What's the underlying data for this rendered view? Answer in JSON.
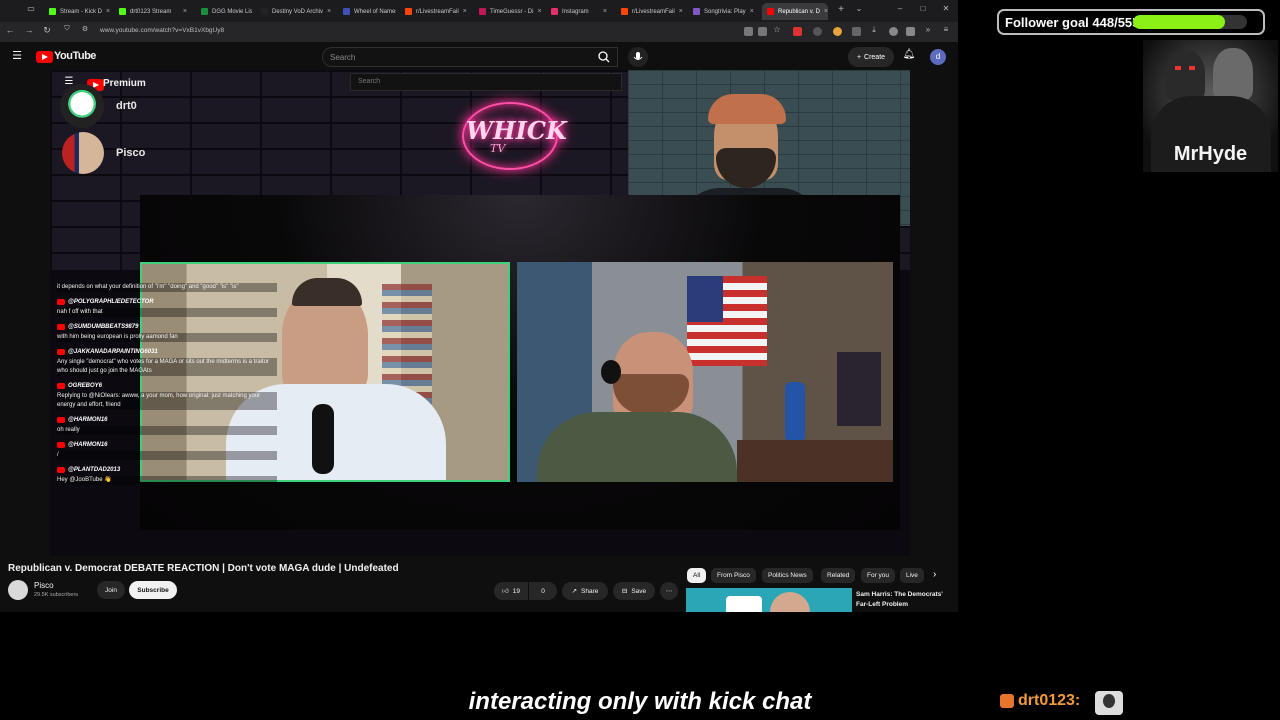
{
  "browser": {
    "tabs": [
      {
        "label": "Stream - Kick D",
        "favicon_color": "#53fc18"
      },
      {
        "label": "drt0123 Stream",
        "favicon_color": "#53fc18"
      },
      {
        "label": "DGG Movie List",
        "favicon_color": "#1e8e3e"
      },
      {
        "label": "Destiny VoD Archiv",
        "favicon_color": "#222222"
      },
      {
        "label": "Wheel of Names",
        "favicon_color": "#3f51b5"
      },
      {
        "label": "r/LivestreamFail",
        "favicon_color": "#ff4500"
      },
      {
        "label": "TimeGuessr - Di",
        "favicon_color": "#c2185b"
      },
      {
        "label": "Instagram",
        "favicon_color": "#e1306c"
      },
      {
        "label": "r/LivestreamFail",
        "favicon_color": "#ff4500"
      },
      {
        "label": "Songtrivia: Play",
        "favicon_color": "#7e57c2"
      },
      {
        "label": "Republican v. D",
        "favicon_color": "#ff0000"
      }
    ],
    "url": "www.youtube.com/watch?v=VxB1vXbgUy8"
  },
  "youtube": {
    "search_placeholder": "Search",
    "create_label": "Create",
    "avatar_letter": "d",
    "video": {
      "title": "Republican v. Democrat DEBATE REACTION | Don't vote MAGA dude | Undefeated",
      "channel": "Pisco",
      "subscribers": "29.5K subscribers",
      "join_label": "Join",
      "subscribe_label": "Subscribe",
      "likes": "19",
      "dislikes": "0",
      "share_label": "Share",
      "save_label": "Save"
    },
    "chips": [
      "All",
      "From Pisco",
      "Politics News",
      "Related",
      "For you",
      "Live"
    ],
    "recommended": {
      "title": "Sam Harris: The Democrats' Far-Left Problem"
    }
  },
  "embedded_stream": {
    "premium_label": "Premium",
    "search_placeholder": "Search",
    "guests": [
      "drt0",
      "Pisco"
    ],
    "neon_logo": "WHICK",
    "neon_logo_sub": "TV"
  },
  "chat": [
    {
      "user": "",
      "message": "it depends on what your definition of \"i'm\" \"doing\" and \"good\" \"is\" \"is\""
    },
    {
      "user": "@POLYGRAPHLIEDETECTOR",
      "message": "nah f off with that"
    },
    {
      "user": "@SUMDUMBBEATS9879",
      "message": "with him being european is prolly aamond fan"
    },
    {
      "user": "@JAKKANADARPAINTING6031",
      "message": "Any single \"democrat\" who votes for a MAGA or sits out the midterms is a traitor who should just go join the MAGAts"
    },
    {
      "user": "OGREBOY6",
      "message": "Replying to @NiOIears: awww, a your mom, how original: just matching your energy and effort, friend"
    },
    {
      "user": "@HARMON16",
      "message": "oh really"
    },
    {
      "user": "@HARMON16",
      "message": "/"
    },
    {
      "user": "@PLANTDAD2013",
      "message": "Hey @JooBTube 👋"
    }
  ],
  "overlay": {
    "follower_goal_label": "Follower goal 448/555",
    "follower_goal_fraction": 0.807,
    "streamer_name": "MrHyde",
    "caption": "interacting only with kick chat",
    "kick_user": "drt0123:"
  }
}
